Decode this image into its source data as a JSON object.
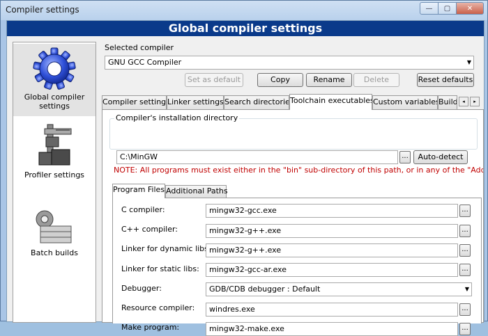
{
  "window": {
    "title": "Compiler settings",
    "controls": {
      "minimize": "—",
      "maximize": "▢",
      "close": "✕"
    }
  },
  "banner": {
    "title": "Global compiler settings"
  },
  "sidebar": {
    "items": [
      {
        "label_line1": "Global compiler",
        "label_line2": "settings",
        "icon": "gear-icon",
        "selected": true
      },
      {
        "label_line1": "Profiler settings",
        "label_line2": "",
        "icon": "caliper-icon",
        "selected": false
      },
      {
        "label_line1": "Batch builds",
        "label_line2": "",
        "icon": "stack-icon",
        "selected": false
      }
    ]
  },
  "compiler": {
    "selected_label": "Selected compiler",
    "value": "GNU GCC Compiler",
    "buttons": {
      "set_default": "Set as default",
      "copy": "Copy",
      "rename": "Rename",
      "delete": "Delete",
      "reset": "Reset defaults"
    }
  },
  "tabs": {
    "items": [
      "Compiler settings",
      "Linker settings",
      "Search directories",
      "Toolchain executables",
      "Custom variables",
      "Build"
    ],
    "active": "Toolchain executables",
    "scroll_left": "◂",
    "scroll_right": "▸"
  },
  "install": {
    "group_title": "Compiler's installation directory",
    "path": "C:\\MinGW",
    "browse_label": "...",
    "autodetect_label": "Auto-detect",
    "note": "NOTE: All programs must exist either in the \"bin\" sub-directory of this path, or in any of the \"Additional"
  },
  "subtabs": {
    "items": [
      "Program Files",
      "Additional Paths"
    ],
    "active": "Program Files"
  },
  "programs": [
    {
      "label": "C compiler:",
      "value": "mingw32-gcc.exe"
    },
    {
      "label": "C++ compiler:",
      "value": "mingw32-g++.exe"
    },
    {
      "label": "Linker for dynamic libs:",
      "value": "mingw32-g++.exe"
    },
    {
      "label": "Linker for static libs:",
      "value": "mingw32-gcc-ar.exe"
    },
    {
      "label": "Debugger:",
      "value": "GDB/CDB debugger : Default"
    },
    {
      "label": "Resource compiler:",
      "value": "windres.exe"
    },
    {
      "label": "Make program:",
      "value": "mingw32-make.exe"
    }
  ],
  "dots_label": "..."
}
